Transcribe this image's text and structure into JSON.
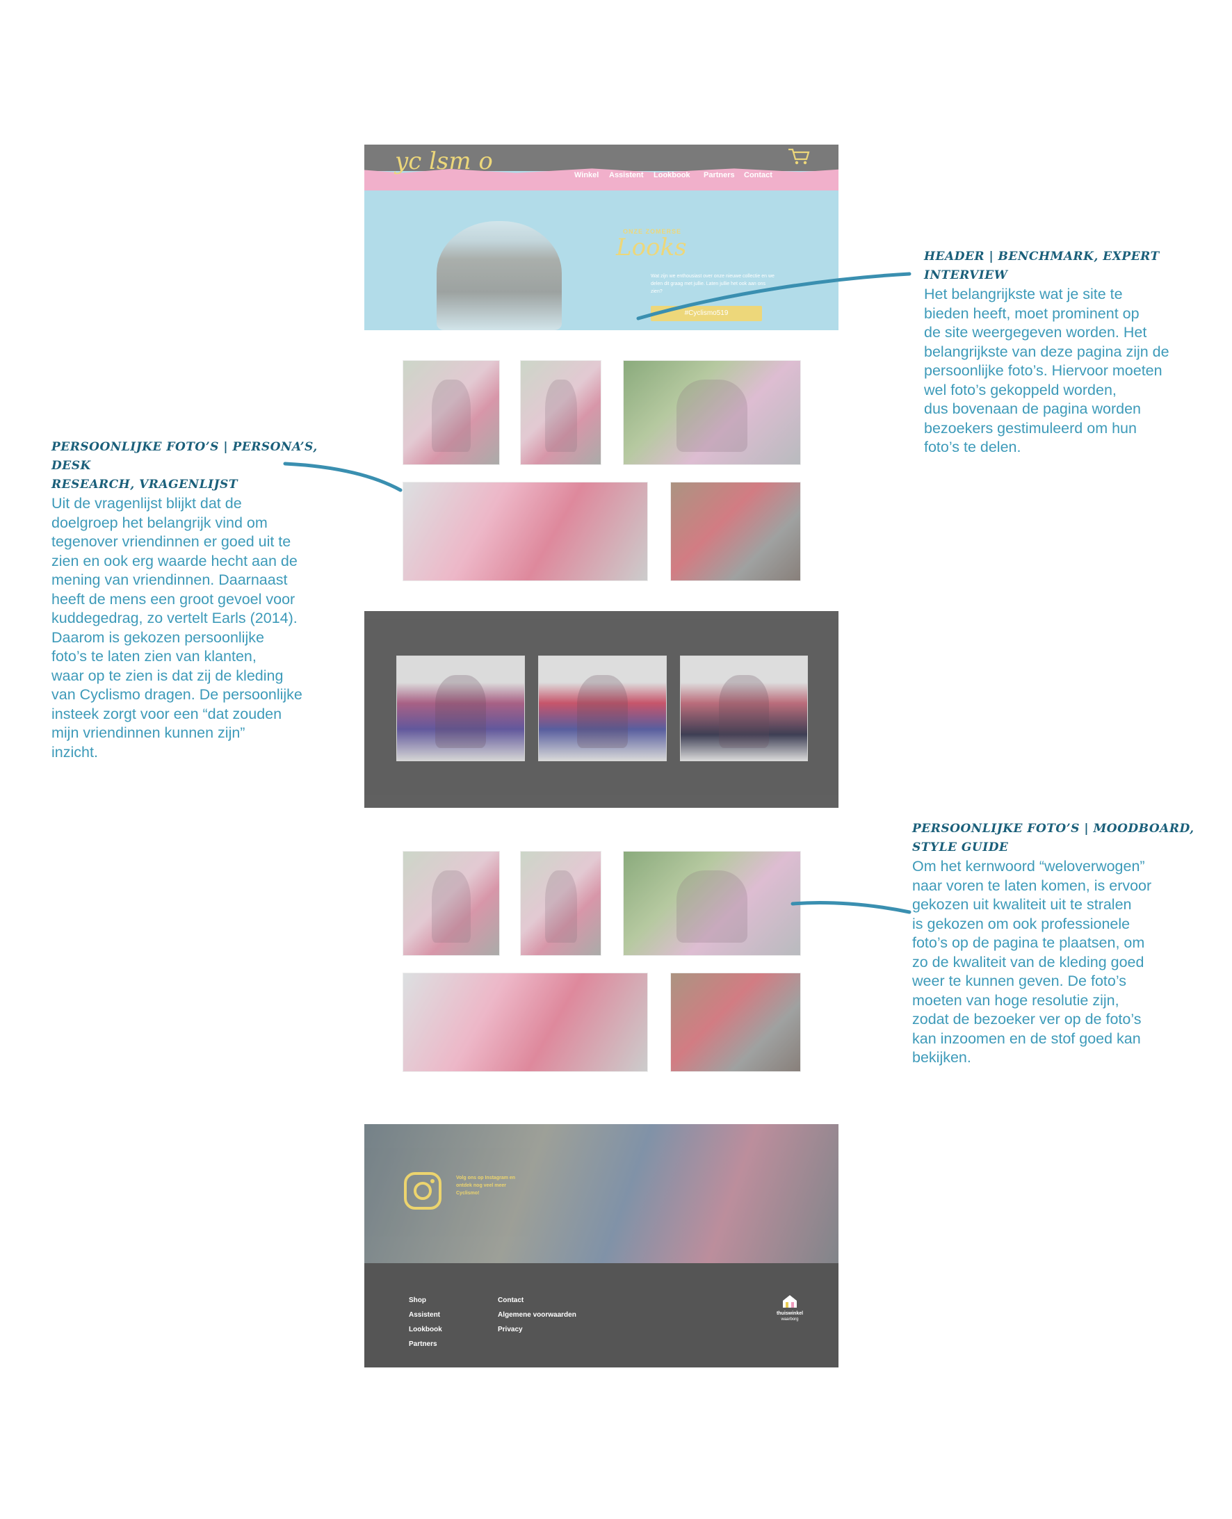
{
  "site": {
    "logo": "yc lsm o",
    "nav": [
      "Winkel",
      "Assistent",
      "Lookbook",
      "Partners",
      "Contact"
    ],
    "hero": {
      "kicker": "ONZE ZOMERSE",
      "title": "Looks",
      "text": "Wat zijn we enthousiast over onze nieuwe collectie en we delen dit graag met jullie. Laten jullie het ook aan ons zien?",
      "button": "#Cyclismo519"
    },
    "footer": {
      "instagram_text": "Volg ons op Instagram en ontdek nog veel meer Cyclismo!",
      "col1": [
        "Shop",
        "Assistent",
        "Lookbook",
        "Partners"
      ],
      "col2": [
        "Contact",
        "Algemene voorwaarden",
        "Privacy"
      ],
      "badge_line1": "thuiswinkel",
      "badge_line2": "waarborg"
    }
  },
  "annotations": {
    "header": {
      "title": "HEADER | BENCHMARK, EXPERT INTERVIEW",
      "body": "Het belangrijkste wat je site te\nbieden heeft, moet prominent op\nde site weergegeven worden. Het\nbelangrijkste van deze pagina zijn de\npersoonlijke foto’s. Hiervoor moeten\nwel foto’s gekoppeld worden,\ndus bovenaan de pagina worden\nbezoekers gestimuleerd om hun\nfoto’s te delen."
    },
    "photos_persona": {
      "title": "PERSOONLIJKE FOTO’S | PERSONA’S, DESK\nRESEARCH, VRAGENLIJST",
      "body": "Uit de vragenlijst blijkt dat de\ndoelgroep het belangrijk vind om\ntegenover vriendinnen er goed uit te\nzien en ook erg waarde hecht aan de\nmening van vriendinnen. Daarnaast\nheeft de mens een groot gevoel voor\nkuddegedrag, zo vertelt Earls (2014).\nDaarom is gekozen persoonlijke\nfoto’s te laten zien van klanten,\nwaar op te zien is dat zij de kleding\nvan Cyclismo dragen. De persoonlijke\ninsteek zorgt voor een “dat zouden\nmijn vriendinnen kunnen zijn”\ninzicht."
    },
    "photos_moodboard": {
      "title": "PERSOONLIJKE FOTO’S | MOODBOARD,\nSTYLE GUIDE",
      "body": "Om het kernwoord “weloverwogen”\nnaar voren te laten komen, is ervoor\ngekozen uit kwaliteit uit te stralen\nis gekozen om ook professionele\nfoto’s op de pagina te plaatsen, om\nzo de kwaliteit van de kleding goed\nweer te kunnen geven. De foto’s\nmoeten van hoge resolutie zijn,\nzodat de bezoeker ver op de foto’s\nkan inzoomen en de stof goed kan\nbekijken."
    }
  },
  "colors": {
    "accent_yellow": "#e9cd55",
    "pink": "#ee9bbd",
    "sky": "#9dd3e3",
    "dark_gray": "#555555",
    "annotation_blue": "#3d9ab9",
    "annotation_title": "#1a5f7a"
  },
  "icons": [
    "cart-icon",
    "instagram-icon",
    "thuiswinkel-logo"
  ]
}
